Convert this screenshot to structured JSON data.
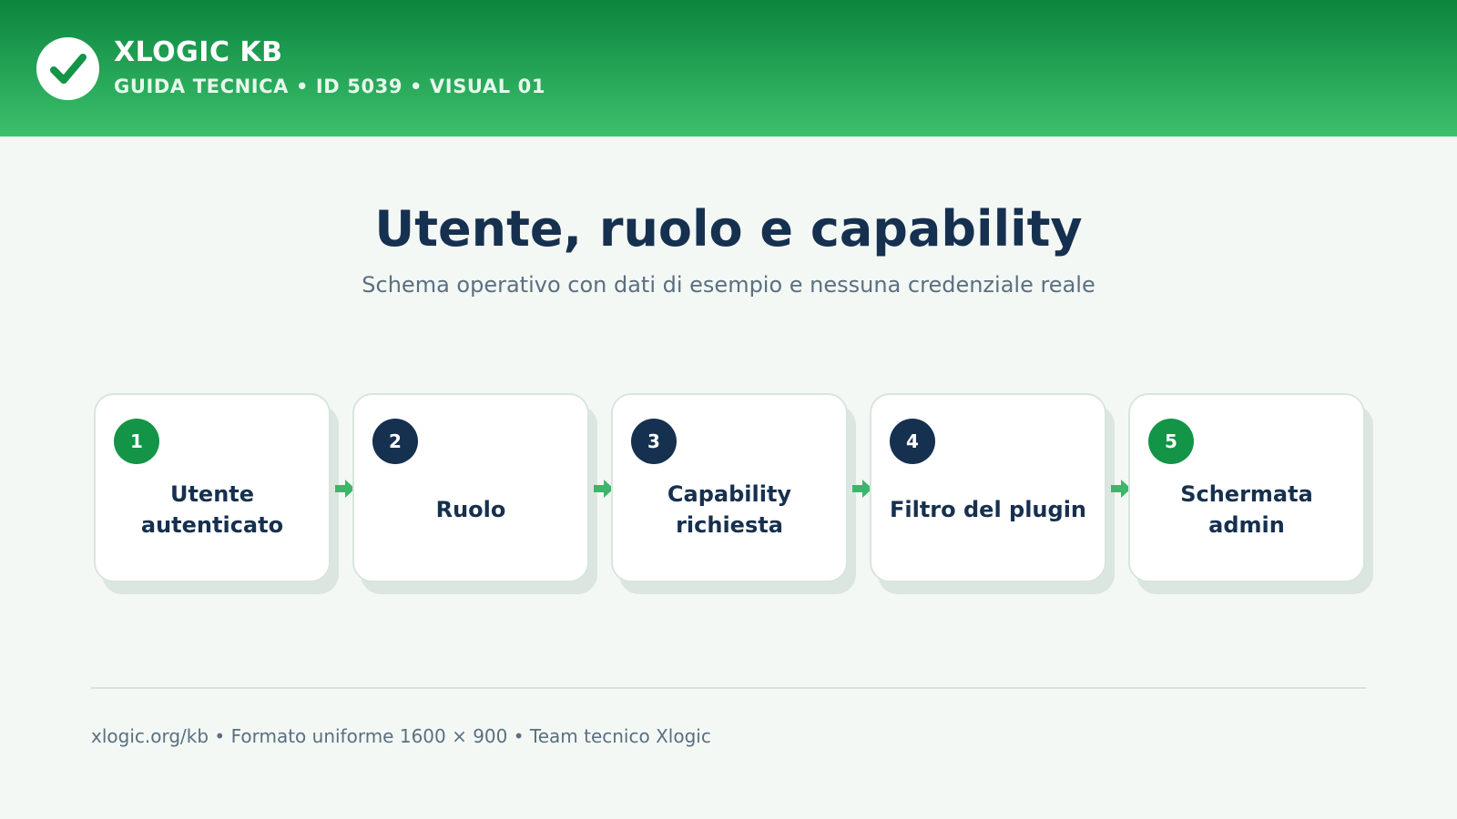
{
  "header": {
    "brand": "XLOGIC KB",
    "subtitle": "GUIDA TECNICA • ID 5039 • VISUAL 01",
    "logo_icon": "check-icon"
  },
  "main": {
    "title": "Utente, ruolo e capability",
    "subtitle": "Schema operativo con dati di esempio e nessuna credenziale reale"
  },
  "steps": [
    {
      "number": "1",
      "label": "Utente autenticato",
      "badge_color": "#139447"
    },
    {
      "number": "2",
      "label": "Ruolo",
      "badge_color": "#16304f"
    },
    {
      "number": "3",
      "label": "Capability richiesta",
      "badge_color": "#16304f"
    },
    {
      "number": "4",
      "label": "Filtro del plugin",
      "badge_color": "#16304f"
    },
    {
      "number": "5",
      "label": "Schermata admin",
      "badge_color": "#139447"
    }
  ],
  "footer": {
    "text": "xlogic.org/kb • Formato uniforme 1600 × 900 • Team tecnico Xlogic"
  },
  "colors": {
    "header_top": "#0b853d",
    "header_bottom": "#3cc06d",
    "accent": "#3cb66a",
    "navy": "#16304f",
    "background": "#f4f8f5"
  }
}
